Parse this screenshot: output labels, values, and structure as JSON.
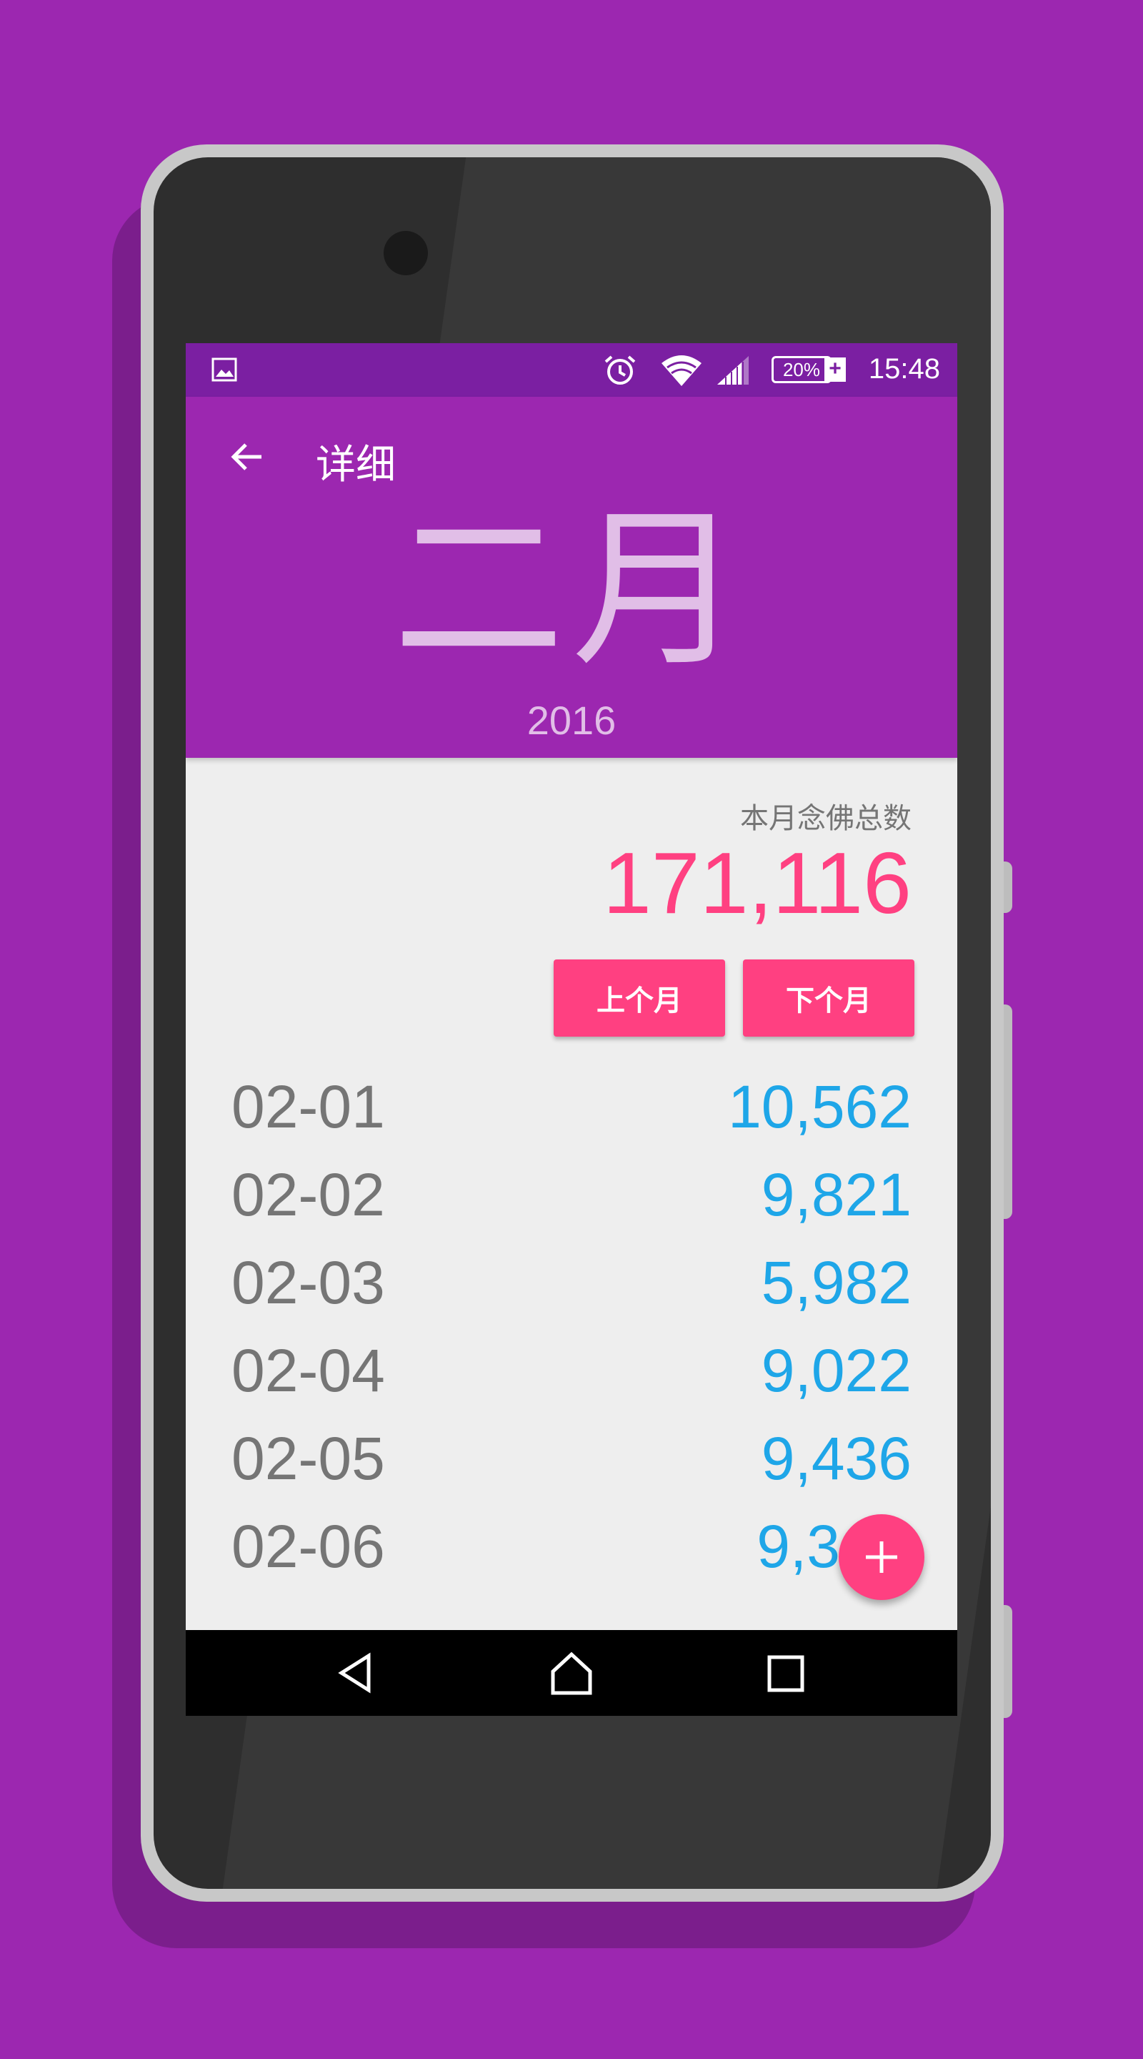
{
  "status_bar": {
    "battery_percent": "20%",
    "battery_plus": "+",
    "time": "15:48",
    "icons": [
      "gallery-icon",
      "alarm-icon",
      "wifi-icon",
      "cell-signal-icon",
      "battery-icon"
    ]
  },
  "toolbar": {
    "back_icon": "arrow-back-icon",
    "title": "详细"
  },
  "header": {
    "month": "二月",
    "year": "2016"
  },
  "summary": {
    "label": "本月念佛总数",
    "total": "171,116"
  },
  "buttons": {
    "prev_month": "上个月",
    "next_month": "下个月"
  },
  "daily_list": [
    {
      "date": "02-01",
      "count": "10,562"
    },
    {
      "date": "02-02",
      "count": "9,821"
    },
    {
      "date": "02-03",
      "count": "5,982"
    },
    {
      "date": "02-04",
      "count": "9,022"
    },
    {
      "date": "02-05",
      "count": "9,436"
    },
    {
      "date": "02-06",
      "count": "9,3"
    }
  ],
  "fab": {
    "icon": "plus-icon"
  },
  "nav_bar": {
    "icons": [
      "back-triangle-icon",
      "home-icon",
      "recents-icon"
    ]
  },
  "colors": {
    "background": "#9C27B0",
    "primary": "#9C27B0",
    "primary_dark": "#7B1FA2",
    "accent": "#FF4081",
    "count_blue": "#1EA6E8",
    "header_text": "#E1BEE7"
  }
}
